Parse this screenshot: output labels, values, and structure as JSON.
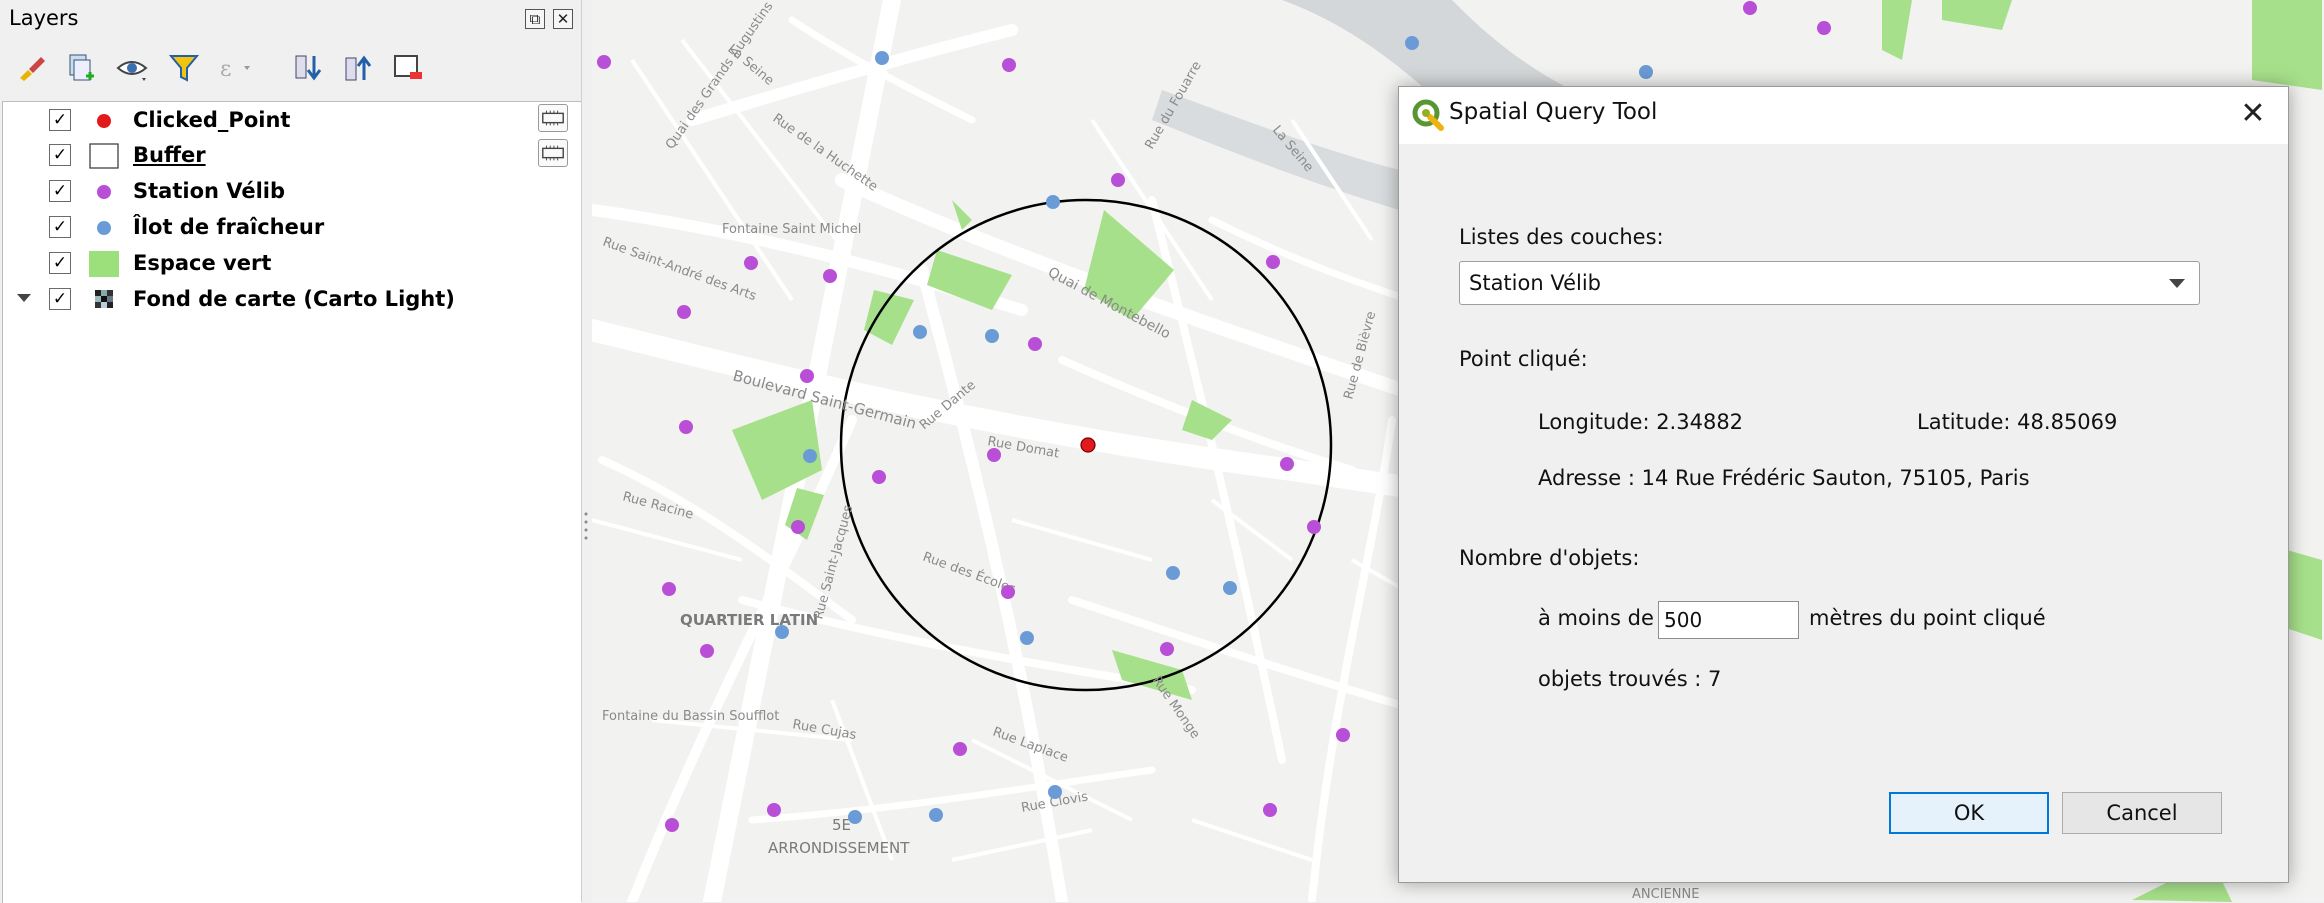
{
  "layers_panel": {
    "title": "Layers",
    "float_btn": "⧉",
    "close_btn": "✕",
    "layers": [
      {
        "name": "Clicked_Point",
        "checked": "✓",
        "symbol": "red-dot-icon",
        "color": "#e31a1c"
      },
      {
        "name": "Buffer",
        "checked": "✓",
        "symbol": "polygon-outline-icon",
        "color": "#ffffff"
      },
      {
        "name": "Station Vélib",
        "checked": "✓",
        "symbol": "purple-dot-icon",
        "color": "#b84fd6"
      },
      {
        "name": "Îlot de fraîcheur",
        "checked": "✓",
        "symbol": "blue-dot-icon",
        "color": "#6b9bd6"
      },
      {
        "name": "Espace vert",
        "checked": "✓",
        "symbol": "green-fill-icon",
        "color": "#9be07a"
      },
      {
        "name": "Fond de carte (Carto Light)",
        "checked": "✓",
        "symbol": "raster-icon",
        "color": "#333333"
      }
    ]
  },
  "map": {
    "labels": [
      "Quai des Grands Augustins",
      "La Seine",
      "Rue de la Huchette",
      "Boulevard Saint-Germain",
      "Quai de Montebello",
      "Rue Dante",
      "Rue des Écoles",
      "QUARTIER LATIN",
      "5E",
      "ARRONDISSEMENT",
      "Rue Saint-Jacques",
      "Rue Saint-André des Arts",
      "Fontaine Saint Michel",
      "Rue Clovis",
      "Fontaine du Bassin Soufflot",
      "Rue Cujas",
      "Rue Laplace",
      "Rue Racine",
      "La Seine",
      "Rue du Fouarre",
      "Rue Domat",
      "Rue de Bièvre",
      "Rue Monge",
      "ANCIENNE"
    ],
    "colors": {
      "velib": "#b84fd6",
      "ilot": "#6b9bd6",
      "clicked": "#e31a1c",
      "green": "#a7e08a",
      "water": "#d4d7d9"
    }
  },
  "dialog": {
    "title": "Spatial Query Tool",
    "close": "✕",
    "layers_label": "Listes des  couches:",
    "layer_selected": "Station Vélib",
    "point_label": "Point cliqué:",
    "longitude": "Longitude: 2.34882",
    "latitude": "Latitude: 48.85069",
    "address": "Adresse : 14 Rue Frédéric Sauton, 75105, Paris",
    "count_label": "Nombre d'objets:",
    "within_prefix": "à moins de",
    "distance_value": "500",
    "within_suffix": "mètres du point cliqué",
    "found": "objets trouvés : 7",
    "ok": "OK",
    "cancel": "Cancel"
  }
}
